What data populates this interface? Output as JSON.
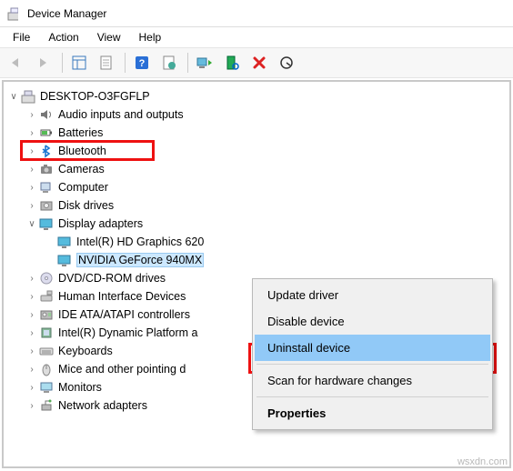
{
  "title": "Device Manager",
  "menu": {
    "file": "File",
    "action": "Action",
    "view": "View",
    "help": "Help"
  },
  "root": "DESKTOP-O3FGFLP",
  "cats": {
    "audio": "Audio inputs and outputs",
    "batt": "Batteries",
    "bt": "Bluetooth",
    "cam": "Cameras",
    "comp": "Computer",
    "disk": "Disk drives",
    "disp": "Display adapters",
    "intel": "Intel(R) HD Graphics 620",
    "nvidia": "NVIDIA GeForce 940MX",
    "dvd": "DVD/CD-ROM drives",
    "hid": "Human Interface Devices",
    "ide": "IDE ATA/ATAPI controllers",
    "dptf": "Intel(R) Dynamic Platform a",
    "kbd": "Keyboards",
    "mouse": "Mice and other pointing d",
    "mon": "Monitors",
    "net": "Network adapters"
  },
  "ctx": {
    "update": "Update driver",
    "disable": "Disable device",
    "uninstall": "Uninstall device",
    "scan": "Scan for hardware changes",
    "props": "Properties"
  },
  "watermark": "wsxdn.com"
}
